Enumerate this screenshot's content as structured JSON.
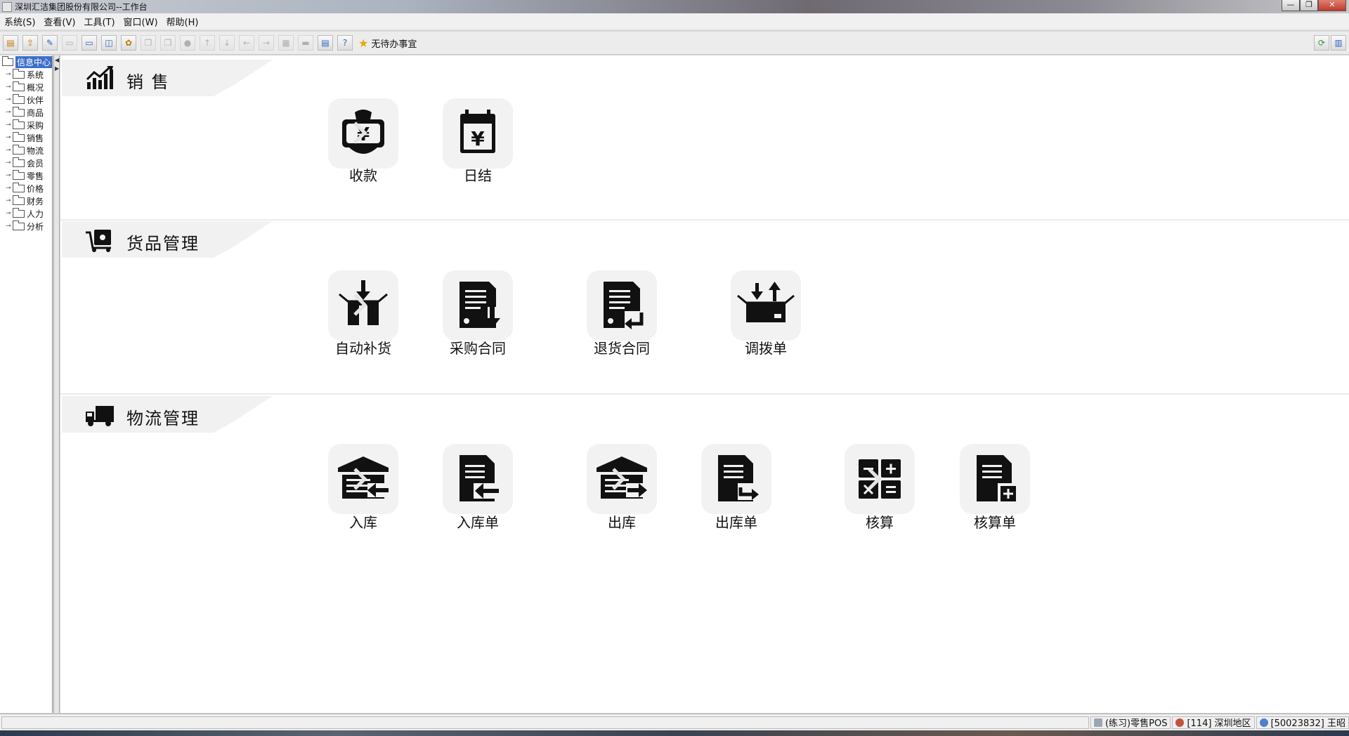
{
  "window": {
    "title": "深圳汇洁集团股份有限公司--工作台",
    "controls": [
      "—",
      "❐",
      "✕"
    ]
  },
  "menubar": [
    "系统(S)",
    "查看(V)",
    "工具(T)",
    "窗口(W)",
    "帮助(H)"
  ],
  "toolbar": {
    "todo_label": "无待办事宜"
  },
  "tree": {
    "root": "信息中心",
    "items": [
      "系统",
      "概况",
      "伙伴",
      "商品",
      "采购",
      "销售",
      "物流",
      "会员",
      "零售",
      "价格",
      "财务",
      "人力",
      "分析"
    ]
  },
  "sections": {
    "sales": {
      "title": "销 售",
      "tiles": [
        {
          "label": "收款",
          "icon": "money-bag-icon"
        },
        {
          "label": "日结",
          "icon": "calendar-yen-icon"
        }
      ]
    },
    "goods": {
      "title": "货品管理",
      "tiles": [
        {
          "label": "自动补货",
          "icon": "box-down-icon"
        },
        {
          "label": "采购合同",
          "icon": "doc-download-icon"
        },
        {
          "label": "退货合同",
          "icon": "doc-return-icon"
        },
        {
          "label": "调拨单",
          "icon": "box-transfer-icon"
        }
      ]
    },
    "logistics": {
      "title": "物流管理",
      "tiles": [
        {
          "label": "入库",
          "icon": "warehouse-in-icon"
        },
        {
          "label": "入库单",
          "icon": "doc-in-icon"
        },
        {
          "label": "出库",
          "icon": "warehouse-out-icon"
        },
        {
          "label": "出库单",
          "icon": "doc-out-icon"
        },
        {
          "label": "核算",
          "icon": "calculator-icon"
        },
        {
          "label": "核算单",
          "icon": "doc-add-icon"
        }
      ]
    }
  },
  "statusbar": {
    "mode": "(练习)零售POS",
    "region": "[114] 深圳地区",
    "user": "[50023832] 王昭"
  }
}
